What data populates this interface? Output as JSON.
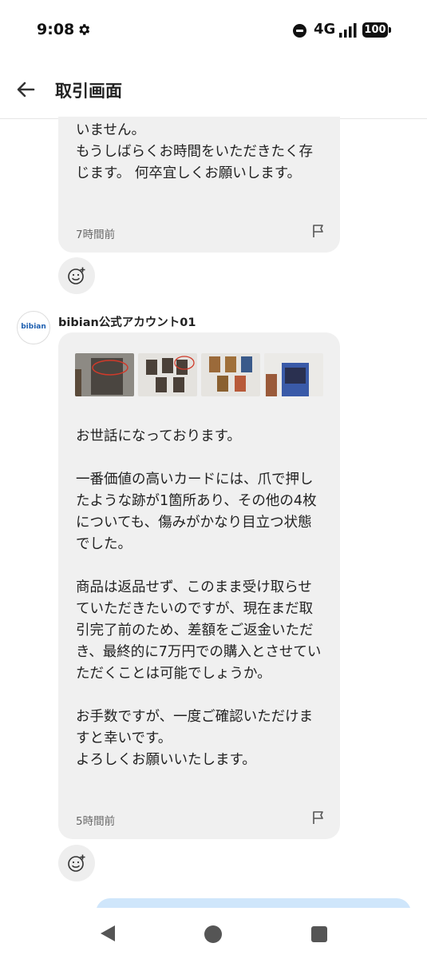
{
  "status_bar": {
    "time": "9:08",
    "network": "4G",
    "battery": "100"
  },
  "header": {
    "title": "取引画面"
  },
  "messages": [
    {
      "text": "いません。\nもうしばらくお時間をいただきたく存じます。 何卒宜しくお願いします。",
      "time": "7時間前"
    },
    {
      "sender": "bibian公式アカウント01",
      "avatar_text": "bibian",
      "text": "お世話になっております。\n\n一番価値の高いカードには、爪で押したような跡が1箇所あり、その他の4枚についても、傷みがかなり目立つ状態でした。\n\n商品は返品せず、このまま受け取らせていただきたいのですが、現在まだ取引完了前のため、差額をご返金いただき、最終的に7万円での購入とさせていただくことは可能でしょうか。\n\nお手数ですが、一度ご確認いただけますと幸いです。\nよろしくお願いいたします。",
      "time": "5時間前"
    }
  ],
  "colors": {
    "bubble_incoming": "#f0f0f0",
    "bubble_outgoing": "#cfe6fb",
    "brand": "#1e5fb0"
  }
}
